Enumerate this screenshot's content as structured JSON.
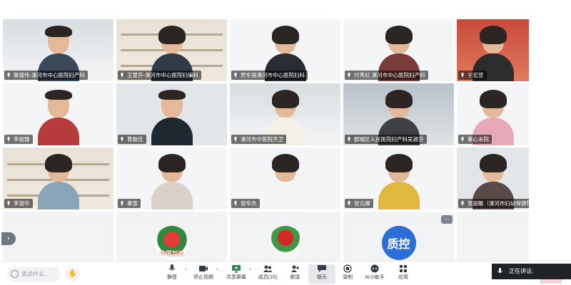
{
  "participants": [
    {
      "name": "聊德伟-漯河市中心医院妇产科"
    },
    {
      "name": "王慧芬-漯河市中心医院妇编科"
    },
    {
      "name": "贾冬丽漯河市中心医院妇科"
    },
    {
      "name": "付秀虹 漯河市中心医院妇产科"
    },
    {
      "name": "宁宏亚"
    },
    {
      "name": "李振魏"
    },
    {
      "name": "曹磊佳"
    },
    {
      "name": "漯河市中医院齐卫"
    },
    {
      "name": "郾城区人民医院妇产科吴淑芬"
    },
    {
      "name": "董心末院"
    },
    {
      "name": "李银华"
    },
    {
      "name": "秦雪"
    },
    {
      "name": "张华杰"
    },
    {
      "name": "张元娜"
    },
    {
      "name": "张丽敏（漯河市妇幼保健院）"
    }
  ],
  "avatars": [
    {
      "caption": "中国加油",
      "kind": "flower"
    },
    {
      "caption": "",
      "kind": "flower2"
    },
    {
      "caption": "质控",
      "kind": "text"
    }
  ],
  "more_label": "···",
  "side_arrow": "›",
  "toolbar": {
    "chat_placeholder": "说点什么...",
    "hand_icon": "✋",
    "buttons": [
      {
        "label": "静音"
      },
      {
        "label": "停止视频"
      },
      {
        "label": "共享屏幕"
      },
      {
        "label": "成员(15)"
      },
      {
        "label": "邀请"
      },
      {
        "label": "聊天"
      },
      {
        "label": "录制"
      },
      {
        "label": "AI小助手"
      },
      {
        "label": "应用"
      }
    ],
    "speaking_label": "正在讲话:"
  },
  "colors": {
    "accent_blue": "#2b6fd6",
    "nametag_bg": "#000000",
    "toolbar_bg": "#ffffff",
    "speaking_bg": "#1f2328"
  }
}
